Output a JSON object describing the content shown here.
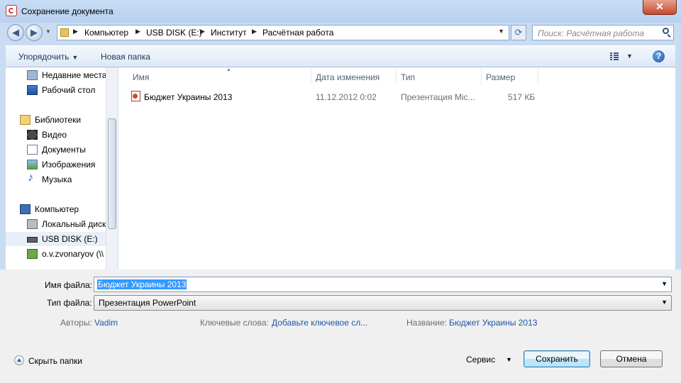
{
  "window": {
    "title": "Сохранение документа",
    "close_label": "✕"
  },
  "address_bar": {
    "crumbs": [
      "Компьютер",
      "USB DISK (E:)",
      "Институт",
      "Расчётная работа"
    ],
    "search_placeholder": "Поиск: Расчётная работа"
  },
  "toolbar": {
    "organize_label": "Упорядочить",
    "new_folder_label": "Новая папка"
  },
  "nav_pane": {
    "items": [
      {
        "label": "Недавние места",
        "icon": "recent-places-icon"
      },
      {
        "label": "Рабочий стол",
        "icon": "desktop-icon"
      },
      {
        "label": "Библиотеки",
        "icon": "libraries-icon"
      },
      {
        "label": "Видео",
        "icon": "video-icon"
      },
      {
        "label": "Документы",
        "icon": "documents-icon"
      },
      {
        "label": "Изображения",
        "icon": "images-icon"
      },
      {
        "label": "Музыка",
        "icon": "music-icon"
      },
      {
        "label": "Компьютер",
        "icon": "computer-icon"
      },
      {
        "label": "Локальный диск",
        "icon": "local-disk-icon"
      },
      {
        "label": "USB DISK (E:)",
        "icon": "usb-drive-icon",
        "selected": true
      },
      {
        "label": "o.v.zvonaryov (\\\\",
        "icon": "network-drive-icon"
      }
    ]
  },
  "file_list": {
    "columns": [
      "Имя",
      "Дата изменения",
      "Тип",
      "Размер"
    ],
    "rows": [
      {
        "name": "Бюджет Украины 2013",
        "date": "11.12.2012 0:02",
        "type": "Презентация Mic...",
        "size": "517 КБ",
        "icon": "powerpoint-file-icon"
      }
    ]
  },
  "form": {
    "filename_label": "Имя файла:",
    "filename_value": "Бюджет Украины 2013",
    "filetype_label": "Тип файла:",
    "filetype_value": "Презентация PowerPoint",
    "authors_label": "Авторы:",
    "authors_value": "Vadim",
    "keywords_label": "Ключевые слова:",
    "keywords_value": "Добавьте ключевое сл...",
    "title_label": "Название:",
    "title_value": "Бюджет Украины 2013"
  },
  "footer": {
    "hide_folders_label": "Скрыть папки",
    "tools_label": "Сервис",
    "save_label": "Сохранить",
    "cancel_label": "Отмена"
  }
}
